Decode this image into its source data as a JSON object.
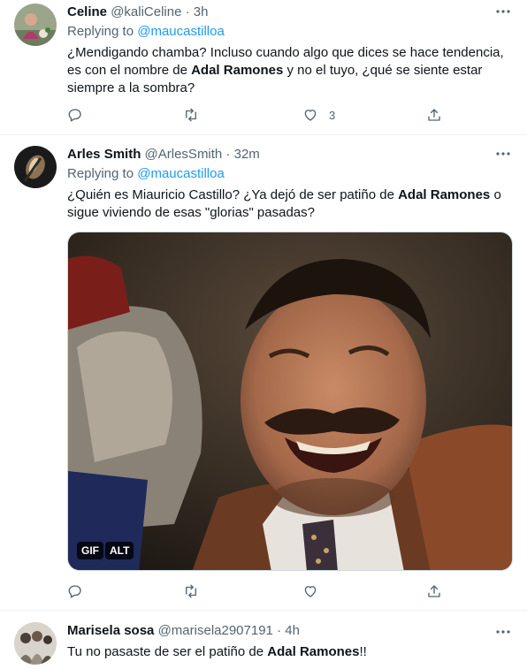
{
  "tweets": [
    {
      "name": "Celine",
      "handle": "@kaliCeline",
      "dot": "·",
      "time": "3h",
      "replying_prefix": "Replying to",
      "replying_to": "@maucastilloa",
      "text_parts": [
        "¿Mendigando chamba? Incluso cuando algo que dices se hace tendencia, es con el nombre de ",
        "Adal Ramones",
        " y no el tuyo, ¿qué se siente estar siempre a la sombra?"
      ],
      "like_count": "3"
    },
    {
      "name": "Arles Smith",
      "handle": "@ArlesSmith",
      "dot": "·",
      "time": "32m",
      "replying_prefix": "Replying to",
      "replying_to": "@maucastilloa",
      "text_parts": [
        "¿Quién es Miauricio Castillo? ¿Ya dejó de ser patiño de ",
        "Adal Ramones",
        " o sigue viviendo de esas \"glorias\" pasadas?"
      ],
      "media_badges": [
        "GIF",
        "ALT"
      ]
    },
    {
      "name": "Marisela sosa",
      "handle": "@marisela2907191",
      "dot": "·",
      "time": "4h",
      "text_parts": [
        "Tu no pasaste de ser el patiño de ",
        "Adal Ramones",
        "!!"
      ]
    }
  ],
  "icons": {
    "reply": "reply-icon",
    "retweet": "retweet-icon",
    "like": "like-icon",
    "share": "share-icon",
    "more": "more-icon"
  },
  "colors": {
    "link": "#1d9bf0",
    "secondary_text": "#536471",
    "primary_text": "#0f1419",
    "divider": "#eff3f4"
  }
}
